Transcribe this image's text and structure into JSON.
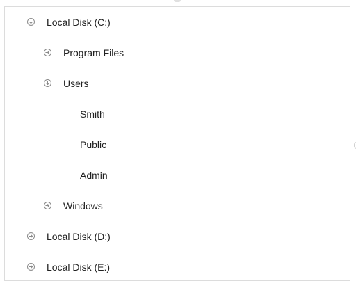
{
  "tree": {
    "nodes": [
      {
        "label": "Local Disk (C:)",
        "level": 0,
        "state": "expanded",
        "icon": "expanded-circle-icon"
      },
      {
        "label": "Program Files",
        "level": 1,
        "state": "collapsed",
        "icon": "collapsed-circle-icon"
      },
      {
        "label": "Users",
        "level": 1,
        "state": "expanded",
        "icon": "expanded-circle-icon"
      },
      {
        "label": "Smith",
        "level": 2,
        "state": "leaf"
      },
      {
        "label": "Public",
        "level": 2,
        "state": "leaf"
      },
      {
        "label": "Admin",
        "level": 2,
        "state": "leaf"
      },
      {
        "label": "Windows",
        "level": 1,
        "state": "collapsed",
        "icon": "collapsed-circle-icon"
      },
      {
        "label": "Local Disk (D:)",
        "level": 0,
        "state": "collapsed",
        "icon": "collapsed-circle-icon"
      },
      {
        "label": "Local Disk (E:)",
        "level": 0,
        "state": "collapsed",
        "icon": "collapsed-circle-icon"
      }
    ]
  },
  "colors": {
    "text": "#212121",
    "icon": "#8a8a8a",
    "border": "#dcdcdc"
  }
}
